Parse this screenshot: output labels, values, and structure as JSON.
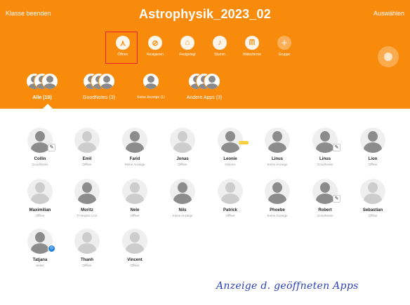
{
  "header": {
    "end_class": "Klasse beenden",
    "title": "Astrophysik_2023_02",
    "select": "Auswählen",
    "accent": "#f88b0b"
  },
  "tools": [
    {
      "label": "Öffnen",
      "icon": "app-open-icon",
      "glyph": "⋏"
    },
    {
      "label": "Navigieren",
      "icon": "compass-icon",
      "glyph": "⊘"
    },
    {
      "label": "Festgelegt",
      "icon": "lock-icon",
      "glyph": "⌂"
    },
    {
      "label": "Stumm",
      "icon": "mute-icon",
      "glyph": "♪"
    },
    {
      "label": "Bildschirme",
      "icon": "binoculars-icon",
      "glyph": "ᗰ"
    },
    {
      "label": "Gruppe",
      "icon": "plus-icon",
      "glyph": "+"
    }
  ],
  "groups": [
    {
      "label": "Alle (19)"
    },
    {
      "label": "GoodNotes (3)"
    },
    {
      "label": "Keine Anzeige (1)"
    },
    {
      "label": "Andere Apps (3)"
    }
  ],
  "students": [
    {
      "name": "Collin",
      "status": "GoodNotes",
      "color": "#8c8c8c",
      "badge": "note"
    },
    {
      "name": "Emil",
      "status": "Offline",
      "color": "#cdcdcd",
      "badge": ""
    },
    {
      "name": "Farid",
      "status": "Keine Anzeige",
      "color": "#8c8c8c",
      "badge": ""
    },
    {
      "name": "Jonas",
      "status": "Offline",
      "color": "#cdcdcd",
      "badge": ""
    },
    {
      "name": "Leonie",
      "status": "Notizen",
      "color": "#8c8c8c",
      "badge": "yellow"
    },
    {
      "name": "Linus",
      "status": "Keine Anzeige",
      "color": "#8c8c8c",
      "badge": ""
    },
    {
      "name": "Linus",
      "status": "GoodNotes",
      "color": "#8c8c8c",
      "badge": "note"
    },
    {
      "name": "Lion",
      "status": "Offline",
      "color": "#8c8c8c",
      "badge": ""
    },
    {
      "name": "Maximilian",
      "status": "Offline",
      "color": "#cdcdcd",
      "badge": ""
    },
    {
      "name": "Moritz",
      "status": "TI-Nspire CAS",
      "color": "#8c8c8c",
      "badge": ""
    },
    {
      "name": "Nele",
      "status": "Offline",
      "color": "#cdcdcd",
      "badge": ""
    },
    {
      "name": "Nils",
      "status": "Keine Anzeige",
      "color": "#8c8c8c",
      "badge": ""
    },
    {
      "name": "Patrick",
      "status": "Offline",
      "color": "#cdcdcd",
      "badge": ""
    },
    {
      "name": "Phoebe",
      "status": "Keine Anzeige",
      "color": "#8c8c8c",
      "badge": ""
    },
    {
      "name": "Robert",
      "status": "GoodNotes",
      "color": "#8c8c8c",
      "badge": "note"
    },
    {
      "name": "Sebastian",
      "status": "Offline",
      "color": "#cdcdcd",
      "badge": ""
    },
    {
      "name": "Tatjana",
      "status": "Safari",
      "color": "#8c8c8c",
      "badge": "blue"
    },
    {
      "name": "Thanh",
      "status": "Offline",
      "color": "#cdcdcd",
      "badge": ""
    },
    {
      "name": "Vincent",
      "status": "Offline",
      "color": "#cdcdcd",
      "badge": ""
    }
  ],
  "annotation": "Anzeige d. geöffneten Apps"
}
